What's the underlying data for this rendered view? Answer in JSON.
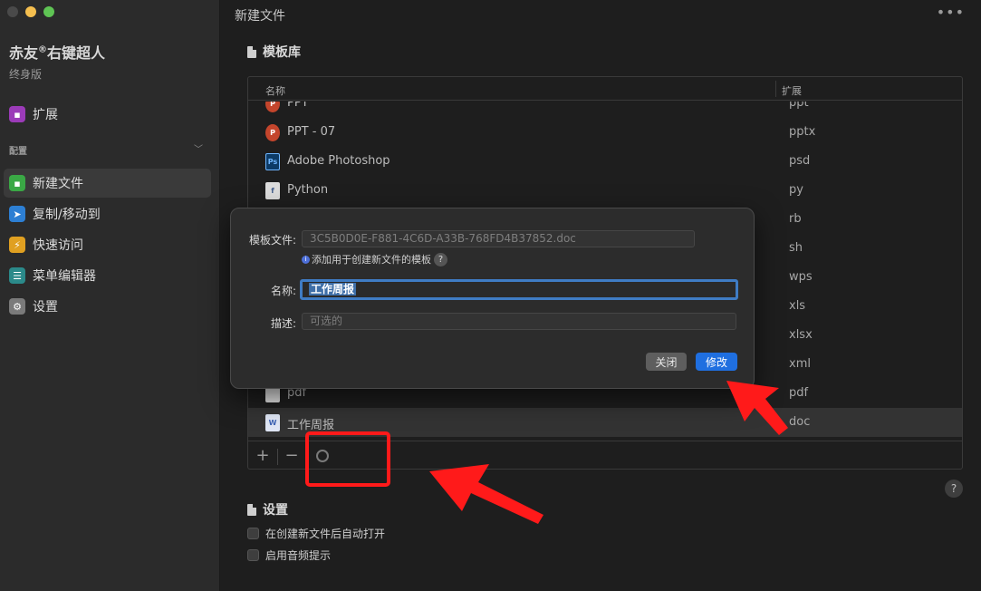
{
  "sidebar": {
    "app_title": "赤友",
    "app_title_sup": "®",
    "app_title_rest": "右键超人",
    "edition": "终身版",
    "ext_item": {
      "label": "扩展",
      "color": "#9b3bb8"
    },
    "section": "配置",
    "items": [
      {
        "label": "新建文件",
        "color": "#3aa845",
        "glyph": "▪"
      },
      {
        "label": "复制/移动到",
        "color": "#2d7fd3",
        "glyph": "➤"
      },
      {
        "label": "快速访问",
        "color": "#e0a021",
        "glyph": "⚡"
      },
      {
        "label": "菜单编辑器",
        "color": "#2b8a8a",
        "glyph": "☰"
      },
      {
        "label": "设置",
        "color": "#7a7a7a",
        "glyph": "⚙"
      }
    ]
  },
  "main": {
    "title": "新建文件",
    "more": "•••",
    "template_section": "模板库",
    "table": {
      "col_name": "名称",
      "col_ext": "扩展",
      "rows": [
        {
          "name": "PPT",
          "ext": "ppt",
          "icon": "P",
          "color": "#c4452c"
        },
        {
          "name": "PPT - 07",
          "ext": "pptx",
          "icon": "P",
          "color": "#c4452c"
        },
        {
          "name": "Adobe Photoshop",
          "ext": "psd",
          "icon": "Ps",
          "color": "#0d3b66"
        },
        {
          "name": "Python",
          "ext": "py",
          "icon": "f",
          "color": "#5a6a8a"
        },
        {
          "name": "",
          "ext": "rb",
          "icon": "",
          "color": "#555"
        },
        {
          "name": "",
          "ext": "sh",
          "icon": "",
          "color": "#555"
        },
        {
          "name": "",
          "ext": "wps",
          "icon": "",
          "color": "#555"
        },
        {
          "name": "",
          "ext": "xls",
          "icon": "",
          "color": "#555"
        },
        {
          "name": "",
          "ext": "xlsx",
          "icon": "",
          "color": "#555"
        },
        {
          "name": "",
          "ext": "xml",
          "icon": "",
          "color": "#555"
        },
        {
          "name": "pdf",
          "ext": "pdf",
          "icon": "",
          "color": "#d23a3a"
        },
        {
          "name": "工作周报",
          "ext": "doc",
          "icon": "W",
          "color": "#3e64b5"
        }
      ],
      "add": "+",
      "remove": "−"
    },
    "settings_section": "设置",
    "checks": [
      "在创建新文件后自动打开",
      "启用音频提示"
    ],
    "help": "?"
  },
  "modal": {
    "file_label": "模板文件:",
    "file_value": "3C5B0D0E-F881-4C6D-A33B-768FD4B37852.doc",
    "hint": "添加用于创建新文件的模板",
    "hint_info": "i",
    "hint_help": "?",
    "name_label": "名称:",
    "name_value": "工作周报",
    "desc_label": "描述:",
    "desc_placeholder": "可选的",
    "close": "关闭",
    "confirm": "修改"
  }
}
